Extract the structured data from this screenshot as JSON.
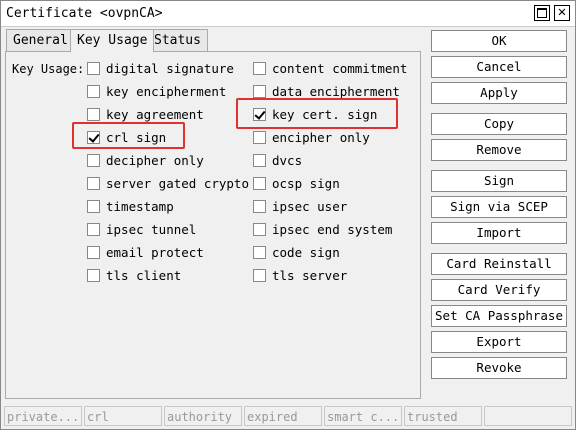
{
  "window": {
    "title": "Certificate <ovpnCA>"
  },
  "tabs": [
    {
      "label": "General"
    },
    {
      "label": "Key Usage"
    },
    {
      "label": "Status"
    }
  ],
  "active_tab": "Key Usage",
  "key_usage": {
    "label": "Key Usage:",
    "left": [
      {
        "label": "digital signature",
        "checked": false
      },
      {
        "label": "key encipherment",
        "checked": false
      },
      {
        "label": "key agreement",
        "checked": false
      },
      {
        "label": "crl sign",
        "checked": true
      },
      {
        "label": "decipher only",
        "checked": false
      },
      {
        "label": "server gated crypto",
        "checked": false
      },
      {
        "label": "timestamp",
        "checked": false
      },
      {
        "label": "ipsec tunnel",
        "checked": false
      },
      {
        "label": "email protect",
        "checked": false
      },
      {
        "label": "tls client",
        "checked": false
      }
    ],
    "right": [
      {
        "label": "content commitment",
        "checked": false
      },
      {
        "label": "data encipherment",
        "checked": false
      },
      {
        "label": "key cert. sign",
        "checked": true
      },
      {
        "label": "encipher only",
        "checked": false
      },
      {
        "label": "dvcs",
        "checked": false
      },
      {
        "label": "ocsp sign",
        "checked": false
      },
      {
        "label": "ipsec user",
        "checked": false
      },
      {
        "label": "ipsec end system",
        "checked": false
      },
      {
        "label": "code sign",
        "checked": false
      },
      {
        "label": "tls server",
        "checked": false
      }
    ]
  },
  "buttons": {
    "ok": "OK",
    "cancel": "Cancel",
    "apply": "Apply",
    "copy": "Copy",
    "remove": "Remove",
    "sign": "Sign",
    "sign_via_scep": "Sign via SCEP",
    "import": "Import",
    "card_reinstall": "Card Reinstall",
    "card_verify": "Card Verify",
    "set_ca_passphrase": "Set CA Passphrase",
    "export": "Export",
    "revoke": "Revoke"
  },
  "status_bar": [
    "private...",
    "crl",
    "authority",
    "expired",
    "smart c...",
    "trusted",
    ""
  ],
  "colors": {
    "highlight": "#e03030"
  }
}
